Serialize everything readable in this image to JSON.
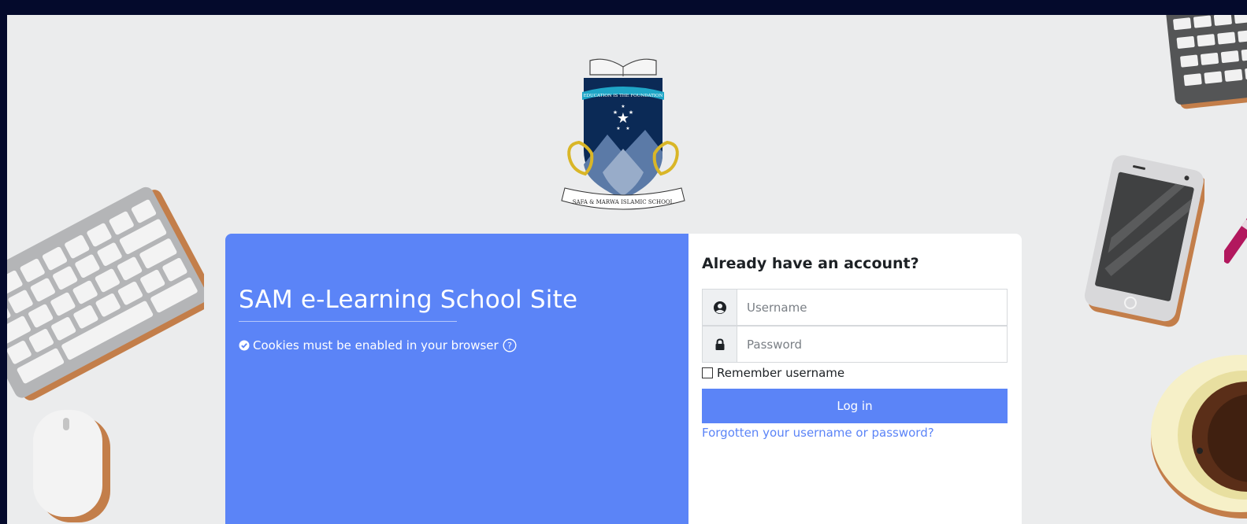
{
  "logo": {
    "motto": "EDUCATION IS THE FOUNDATION",
    "school_name": "SAFA & MARWA ISLAMIC SCHOOL"
  },
  "left_panel": {
    "site_title": "SAM e-Learning School Site",
    "cookie_notice": "Cookies must be enabled in your browser",
    "cookie_icon": "check-circle-icon",
    "help_icon": "question-circle-icon"
  },
  "login": {
    "heading": "Already have an account?",
    "username_placeholder": "Username",
    "password_placeholder": "Password",
    "remember_label": "Remember username",
    "login_button": "Log in",
    "forgot_link": "Forgotten your username or password?"
  },
  "colors": {
    "frame": "#040a2c",
    "background": "#ebeced",
    "accent": "#5b84f7",
    "panel": "#ffffff"
  }
}
